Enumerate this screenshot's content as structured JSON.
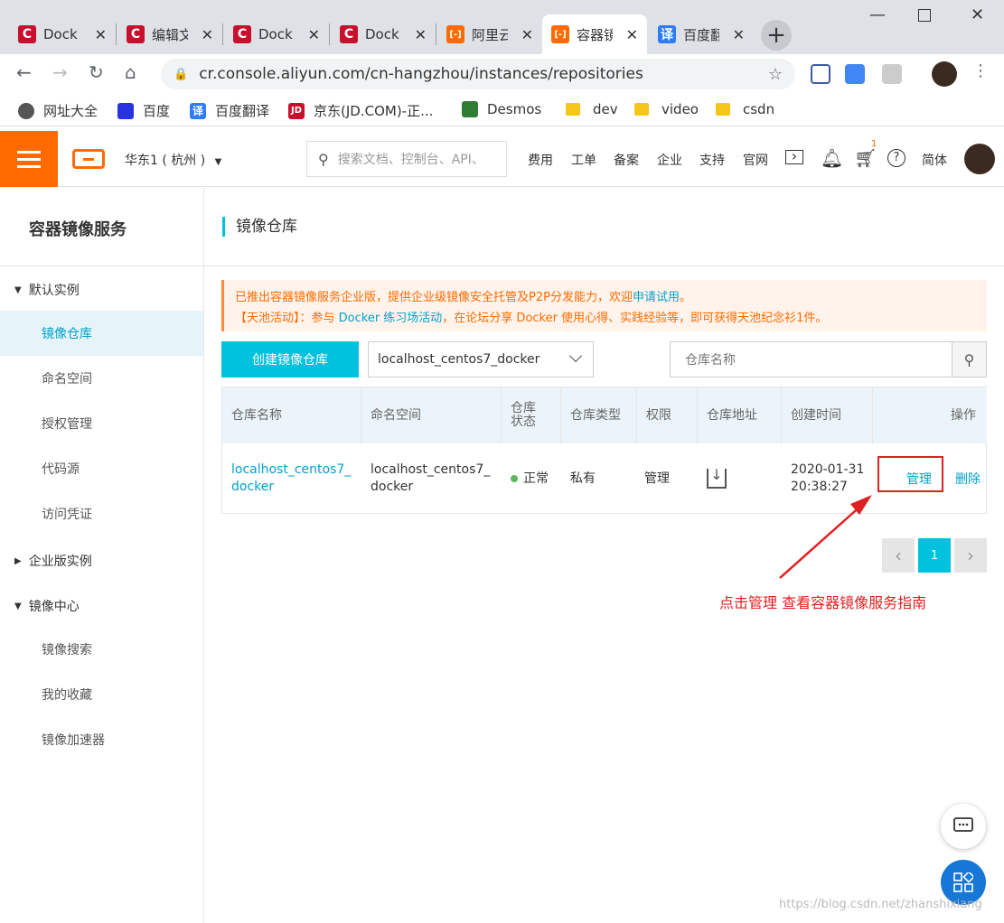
{
  "browser": {
    "tabs": [
      {
        "label": "Dock",
        "favicon": "C",
        "color": "#c8102e"
      },
      {
        "label": "编辑文",
        "favicon": "C",
        "color": "#c8102e"
      },
      {
        "label": "Dock",
        "favicon": "C",
        "color": "#c8102e"
      },
      {
        "label": "Dock",
        "favicon": "C",
        "color": "#c8102e"
      },
      {
        "label": "阿里云",
        "favicon": "[-]",
        "color": "#ff6a00"
      },
      {
        "label": "容器镜",
        "favicon": "[-]",
        "color": "#ff6a00"
      },
      {
        "label": "百度翻",
        "favicon": "译",
        "color": "#2e7cf6"
      }
    ],
    "url": "cr.console.aliyun.com/cn-hangzhou/instances/repositories",
    "bookmarks": [
      {
        "label": "网址大全"
      },
      {
        "label": "百度"
      },
      {
        "label": "百度翻译"
      },
      {
        "label": "京东(JD.COM)-正..."
      },
      {
        "label": "Desmos"
      },
      {
        "label": "dev"
      },
      {
        "label": "video"
      },
      {
        "label": "csdn"
      }
    ]
  },
  "topnav": {
    "region": "华东1 ( 杭州 )",
    "search_placeholder": "搜索文档、控制台、API、",
    "links": [
      "费用",
      "工单",
      "备案",
      "企业",
      "支持",
      "官网"
    ],
    "cart_badge": "1",
    "lang": "简体"
  },
  "sidebar": {
    "title": "容器镜像服务",
    "groups": [
      {
        "label": "默认实例",
        "expanded": true,
        "items": [
          "镜像仓库",
          "命名空间",
          "授权管理",
          "代码源",
          "访问凭证"
        ]
      },
      {
        "label": "企业版实例",
        "expanded": false,
        "items": []
      },
      {
        "label": "镜像中心",
        "expanded": true,
        "items": [
          "镜像搜索",
          "我的收藏",
          "镜像加速器"
        ]
      }
    ]
  },
  "main": {
    "title": "镜像仓库",
    "notice": {
      "line1": "已推出容器镜像服务企业版，提供企业级镜像安全托管及P2P分发能力，欢迎",
      "line1_link": "申请试用",
      "line1_end": "。",
      "line2_a": "【天池活动】：参与 ",
      "line2_link": "Docker 练习场活动",
      "line2_b": "，在论坛分享 Docker 使用心得、实践经验等，即可获得天池纪念衫1件。"
    },
    "create_button": "创建镜像仓库",
    "namespace_select": "localhost_centos7_docker",
    "repo_search_placeholder": "仓库名称",
    "table": {
      "headers": [
        "仓库名称",
        "命名空间",
        "仓库状态",
        "仓库类型",
        "权限",
        "仓库地址",
        "创建时间",
        "操作"
      ],
      "rows": [
        {
          "name_line1": "localhost_centos7_",
          "name_line2": "docker",
          "namespace_line1": "localhost_centos7_",
          "namespace_line2": "docker",
          "status": "正常",
          "type": "私有",
          "permission": "管理",
          "created_line1": "2020-01-31",
          "created_line2": "20:38:27",
          "action_manage": "管理",
          "action_delete": "删除"
        }
      ]
    },
    "pagination": {
      "current": "1"
    },
    "annotation": "点击管理 查看容器镜像服务指南"
  },
  "watermark": "https://blog.csdn.net/zhanshixiang"
}
